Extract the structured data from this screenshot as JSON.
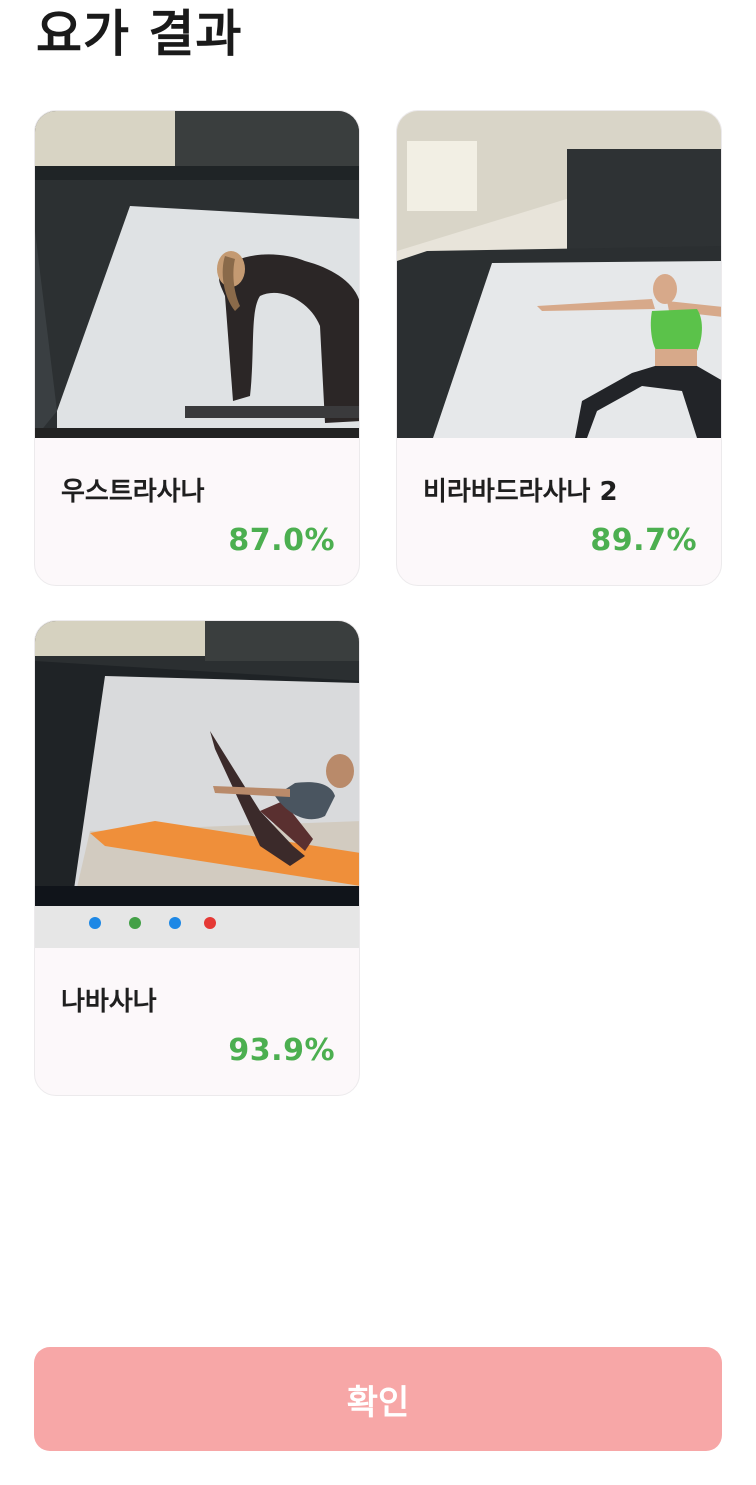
{
  "header": {
    "title": "요가 결과"
  },
  "results": [
    {
      "name": "우스트라사나",
      "score": "87.0%",
      "image_icon": "ustrasana-pose-photo"
    },
    {
      "name": "비라바드라사나 2",
      "score": "89.7%",
      "image_icon": "virabhadrasana-2-pose-photo"
    },
    {
      "name": "나바사나",
      "score": "93.9%",
      "image_icon": "navasana-pose-photo"
    }
  ],
  "footer": {
    "confirm_label": "확인"
  },
  "colors": {
    "accent": "#f7a7a7",
    "score": "#4caf50",
    "card_bg": "#fcf8fa"
  }
}
